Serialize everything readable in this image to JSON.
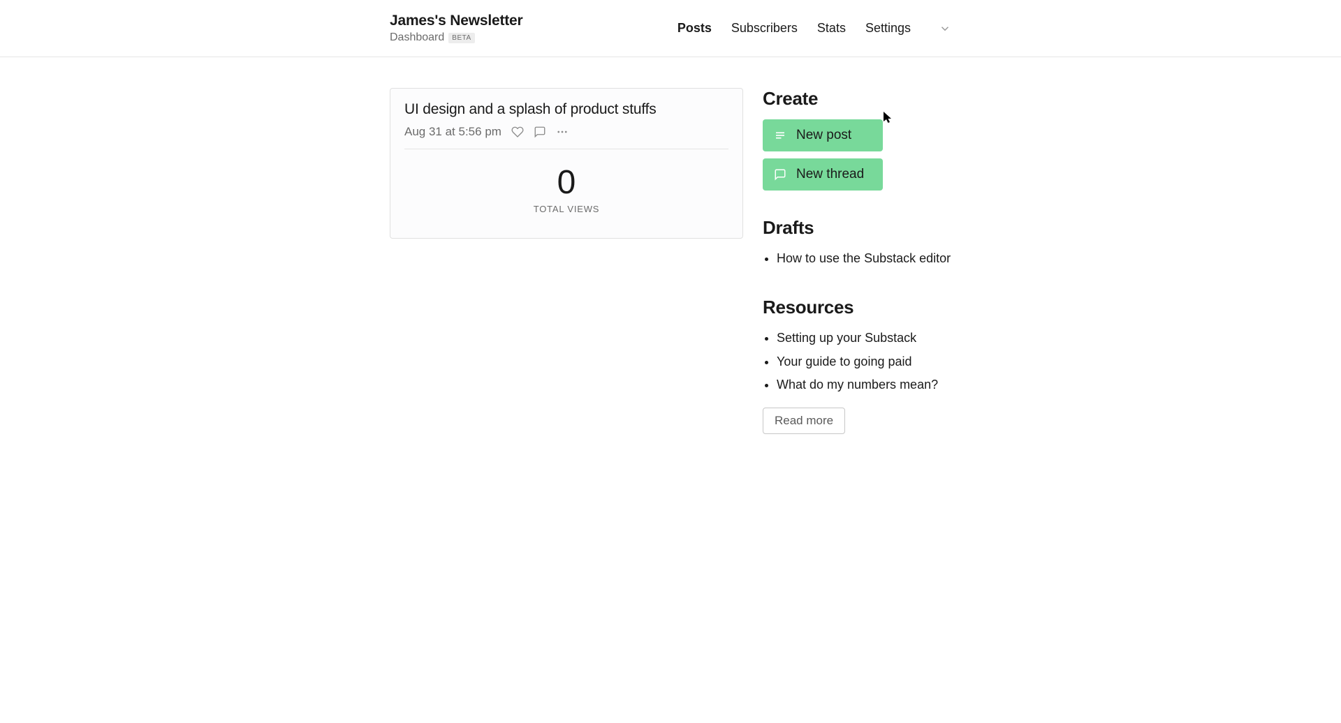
{
  "header": {
    "title": "James's Newsletter",
    "subtitle": "Dashboard",
    "badge": "BETA",
    "nav": [
      {
        "label": "Posts",
        "active": true
      },
      {
        "label": "Subscribers",
        "active": false
      },
      {
        "label": "Stats",
        "active": false
      },
      {
        "label": "Settings",
        "active": false
      }
    ]
  },
  "post": {
    "title": "UI design and a splash of product stuffs",
    "date": "Aug 31 at 5:56 pm",
    "views_value": "0",
    "views_label": "TOTAL VIEWS"
  },
  "create": {
    "heading": "Create",
    "new_post": "New post",
    "new_thread": "New thread"
  },
  "drafts": {
    "heading": "Drafts",
    "items": [
      "How to use the Substack editor"
    ]
  },
  "resources": {
    "heading": "Resources",
    "items": [
      "Setting up your Substack",
      "Your guide to going paid",
      "What do my numbers mean?"
    ],
    "read_more": "Read more"
  }
}
